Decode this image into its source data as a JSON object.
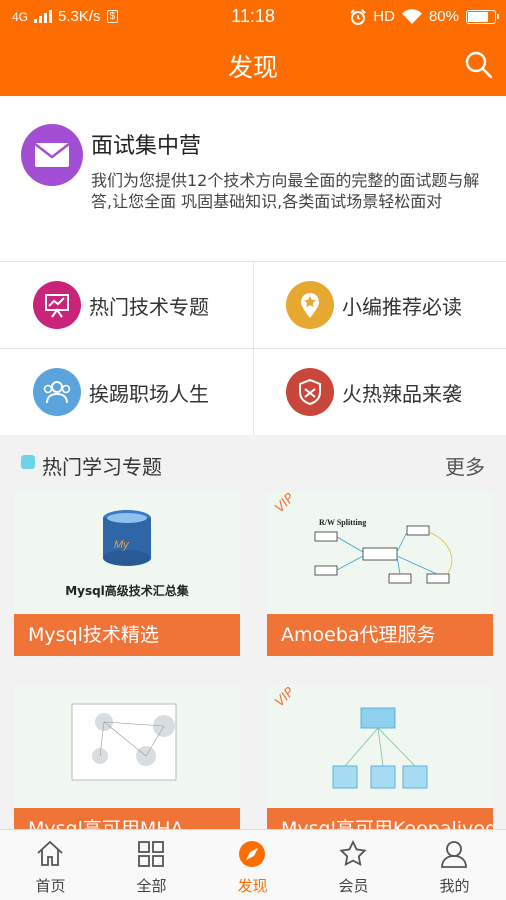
{
  "status": {
    "network": "4G",
    "speed": "5.3K/s",
    "time": "11:18",
    "hd": "HD",
    "battery": "80%",
    "battery_level": 0.8
  },
  "header": {
    "title": "发现"
  },
  "promo": {
    "title": "面试集中营",
    "description": "我们为您提供12个技术方向最全面的完整的面试题与解答,让您全面 巩固基础知识,各类面试场景轻松面对"
  },
  "quick_links": [
    {
      "label": "热门技术专题",
      "icon": "presentation-icon",
      "color": "#c9247a"
    },
    {
      "label": "小编推荐必读",
      "icon": "location-star-icon",
      "color": "#e6a830"
    },
    {
      "label": "挨踢职场人生",
      "icon": "people-icon",
      "color": "#5aa3dc"
    },
    {
      "label": "火热辣品来袭",
      "icon": "shield-icon",
      "color": "#c9473a"
    }
  ],
  "section": {
    "title": "热门学习专题",
    "more": "更多"
  },
  "courses": [
    {
      "title": "Mysql技术精选",
      "thumb_text": "Mysql高级技术汇总集",
      "vip": ""
    },
    {
      "title": "Amoeba代理服务",
      "thumb_text": "R/W Splitting",
      "vip": "VIP"
    },
    {
      "title": "Mysql高可用MHA",
      "thumb_text": "",
      "vip": ""
    },
    {
      "title": "Mysql高可用Keepalived",
      "thumb_text": "",
      "vip": "VIP"
    }
  ],
  "tabbar": [
    {
      "label": "首页",
      "icon": "home-icon"
    },
    {
      "label": "全部",
      "icon": "grid-icon"
    },
    {
      "label": "发现",
      "icon": "compass-icon",
      "active": true
    },
    {
      "label": "会员",
      "icon": "star-icon"
    },
    {
      "label": "我的",
      "icon": "person-icon"
    }
  ]
}
